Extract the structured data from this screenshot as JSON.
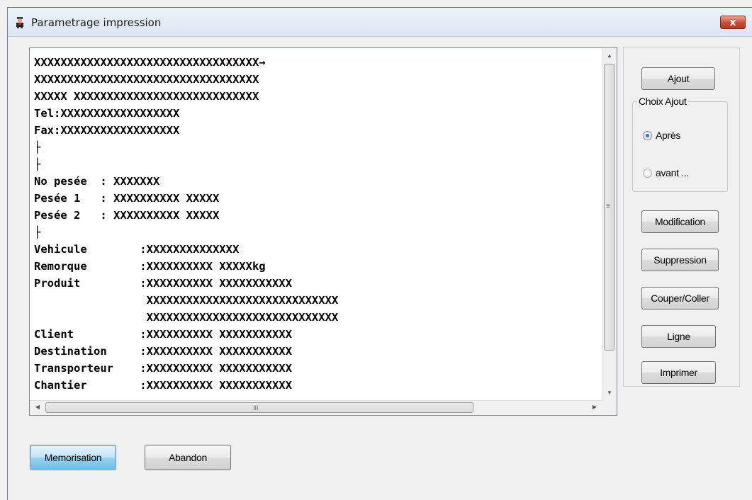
{
  "window": {
    "title": "Parametrage impression",
    "close_glyph": "x"
  },
  "editor": {
    "lines": [
      "XXXXXXXXXXXXXXXXXXXXXXXXXXXXXXXXXX→",
      "XXXXXXXXXXXXXXXXXXXXXXXXXXXXXXXXXX",
      "XXXXX XXXXXXXXXXXXXXXXXXXXXXXXXXXX",
      "Tel:XXXXXXXXXXXXXXXXXX",
      "Fax:XXXXXXXXXXXXXXXXXX",
      "├",
      "├",
      "No pesée  : XXXXXXX",
      "Pesée 1   : XXXXXXXXXX XXXXX",
      "Pesée 2   : XXXXXXXXXX XXXXX",
      "├",
      "Vehicule        :XXXXXXXXXXXXXX",
      "Remorque        :XXXXXXXXXX XXXXXkg",
      "Produit         :XXXXXXXXXX XXXXXXXXXXX",
      "                 XXXXXXXXXXXXXXXXXXXXXXXXXXXXX",
      "                 XXXXXXXXXXXXXXXXXXXXXXXXXXXXX",
      "Client          :XXXXXXXXXX XXXXXXXXXXX",
      "Destination     :XXXXXXXXXX XXXXXXXXXXX",
      "Transporteur    :XXXXXXXXXX XXXXXXXXXXX",
      "Chantier        :XXXXXXXXXX XXXXXXXXXXX"
    ],
    "scroll_up": "▲",
    "scroll_down": "▼",
    "scroll_left": "◀",
    "scroll_right": "▶",
    "vgrip": "≡",
    "hgrip": "III"
  },
  "side_panel": {
    "ajout": "Ajout",
    "choix_ajout": "Choix Ajout",
    "apres": "Après",
    "avant": "avant ...",
    "apres_selected": true,
    "modification": "Modification",
    "suppression": "Suppression",
    "couper_coller": "Couper/Coller",
    "ligne": "Ligne",
    "imprimer": "Imprimer"
  },
  "footer": {
    "memorisation": "Memorisation",
    "abandon": "Abandon"
  }
}
